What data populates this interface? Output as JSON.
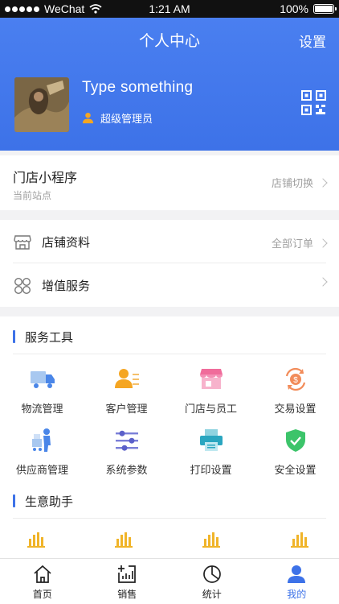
{
  "status_bar": {
    "carrier": "WeChat",
    "time": "1:21 AM",
    "battery": "100%"
  },
  "header": {
    "title": "个人中心",
    "settings_label": "设置",
    "username": "Type something",
    "role": "超级管理员"
  },
  "store": {
    "title": "门店小程序",
    "subtitle": "当前站点",
    "switch_label": "店铺切换"
  },
  "menu": [
    {
      "label": "店铺资料",
      "right": "全部订单"
    },
    {
      "label": "增值服务",
      "right": ""
    }
  ],
  "service_tools": {
    "title": "服务工具",
    "items": [
      {
        "label": "物流管理",
        "icon": "truck-icon"
      },
      {
        "label": "客户管理",
        "icon": "customer-icon"
      },
      {
        "label": "门店与员工",
        "icon": "store-icon"
      },
      {
        "label": "交易设置",
        "icon": "exchange-icon"
      },
      {
        "label": "供应商管理",
        "icon": "supplier-icon"
      },
      {
        "label": "系统参数",
        "icon": "sliders-icon"
      },
      {
        "label": "打印设置",
        "icon": "printer-icon"
      },
      {
        "label": "安全设置",
        "icon": "shield-icon"
      }
    ]
  },
  "business_helper": {
    "title": "生意助手"
  },
  "tabbar": [
    {
      "label": "首页",
      "icon": "home-icon",
      "active": false
    },
    {
      "label": "销售",
      "icon": "sales-chart-icon",
      "active": false
    },
    {
      "label": "统计",
      "icon": "pie-chart-icon",
      "active": false
    },
    {
      "label": "我的",
      "icon": "user-icon",
      "active": true
    }
  ],
  "colors": {
    "primary": "#3d72e8",
    "accent_orange": "#f0a830",
    "muted_text": "#a0a0a0"
  }
}
